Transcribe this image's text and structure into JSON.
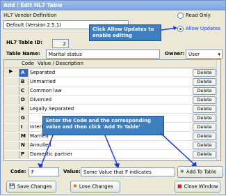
{
  "window": {
    "title": "Add / Edit HL7 Table"
  },
  "vendor": {
    "label": "HL7 Vendor Definition",
    "value": "Default (Version 2.5.1)"
  },
  "mode": {
    "read_only": "Read Only",
    "allow_updates": "Allow Updates",
    "selected": "allow_updates"
  },
  "callout_top": "Click Allow Updates to enable editing",
  "table_id": {
    "label": "HL7 Table ID:",
    "value": "2"
  },
  "table_name": {
    "label": "Table Name:",
    "value": "Marital status"
  },
  "owner": {
    "label": "Owner:",
    "value": "User"
  },
  "grid": {
    "col_code": "Code",
    "col_value": "Value / Description",
    "delete_label": "Delete",
    "rows": [
      {
        "code": "A",
        "value": "Separated"
      },
      {
        "code": "B",
        "value": "Unmarried"
      },
      {
        "code": "C",
        "value": "Common law"
      },
      {
        "code": "D",
        "value": "Divorced"
      },
      {
        "code": "E",
        "value": "Legally Separated"
      },
      {
        "code": "G",
        "value": ""
      },
      {
        "code": "I",
        "value": "Interlocutory"
      },
      {
        "code": "M",
        "value": "Married"
      },
      {
        "code": "N",
        "value": "Annulled"
      },
      {
        "code": "P",
        "value": "Domestic partner"
      }
    ]
  },
  "callout_bottom": "Enter the Code and the corresponding value and then click 'Add To Table'",
  "code_field": {
    "label": "Code:",
    "value": "F"
  },
  "value_field": {
    "label": "Value:",
    "value": "Some Value that F indicates"
  },
  "add_button": "Add To Table",
  "save_button": "Save Changes",
  "lose_button": "Lose Changes",
  "close_button": "Close Window",
  "colors": {
    "title_bar": "#7aa3dc",
    "callout": "#3f7fc0",
    "selection": "#316ac5",
    "arrow": "#1a3ad0"
  }
}
